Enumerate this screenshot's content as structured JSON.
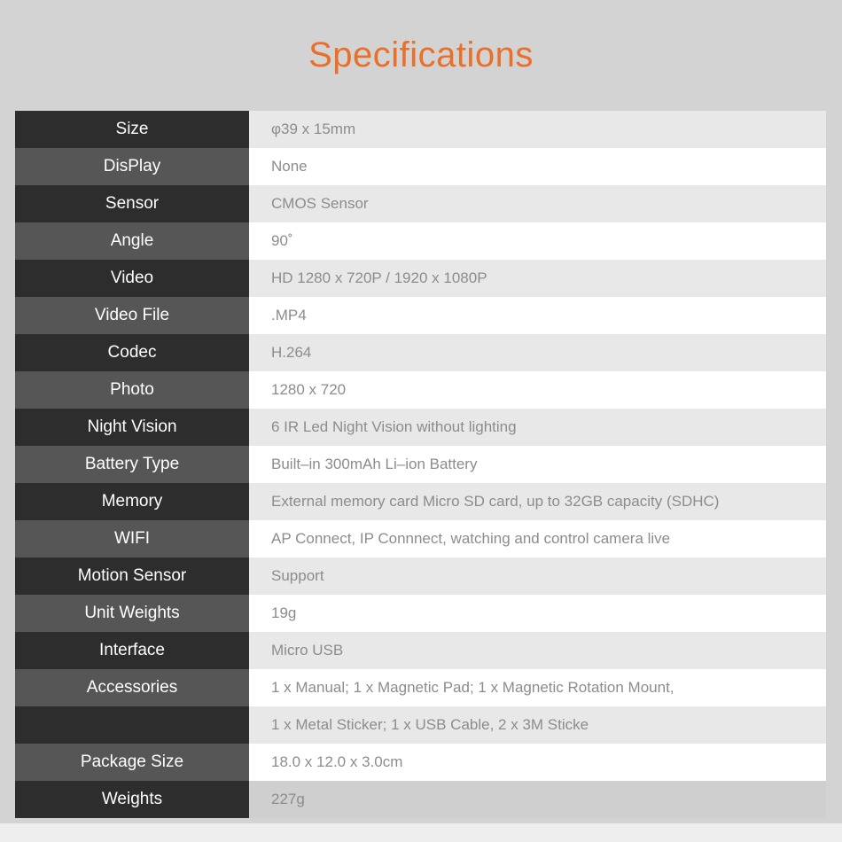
{
  "page": {
    "title": "Specifications",
    "title_color": "#e8702a",
    "background_color": "#d3d3d3"
  },
  "table": {
    "label_colors": {
      "dark": "#2d2d2d",
      "mid": "#565656"
    },
    "value_colors": {
      "dark": "#e8e8e8",
      "mid": "#ffffff",
      "last": "#cfcfcf"
    },
    "rows": [
      {
        "label": "Size",
        "value": "φ39 x 15mm",
        "style": "dark"
      },
      {
        "label": "DisPlay",
        "value": "None",
        "style": "mid"
      },
      {
        "label": "Sensor",
        "value": "CMOS Sensor",
        "style": "dark"
      },
      {
        "label": "Angle",
        "value": "90˚",
        "style": "mid"
      },
      {
        "label": "Video",
        "value": "HD 1280 x 720P / 1920 x 1080P",
        "style": "dark"
      },
      {
        "label": "Video File",
        "value": ".MP4",
        "style": "mid"
      },
      {
        "label": "Codec",
        "value": "H.264",
        "style": "dark"
      },
      {
        "label": "Photo",
        "value": "1280 x 720",
        "style": "mid"
      },
      {
        "label": "Night Vision",
        "value": "6 IR Led Night Vision without lighting",
        "style": "dark"
      },
      {
        "label": "Battery Type",
        "value": "Built–in 300mAh Li–ion Battery",
        "style": "mid"
      },
      {
        "label": "Memory",
        "value": "External memory card Micro SD card, up to 32GB capacity (SDHC)",
        "style": "dark"
      },
      {
        "label": "WIFI",
        "value": "AP Connect,  IP Connnect, watching and control camera live",
        "style": "mid"
      },
      {
        "label": "Motion Sensor",
        "value": "Support",
        "style": "dark"
      },
      {
        "label": "Unit Weights",
        "value": "19g",
        "style": "mid"
      },
      {
        "label": "Interface",
        "value": "Micro USB",
        "style": "dark"
      },
      {
        "label": "Accessories",
        "value": "1 x Manual; 1 x Magnetic Pad; 1 x Magnetic Rotation Mount,",
        "style": "mid"
      },
      {
        "label": "",
        "value": "1 x Metal Sticker; 1 x USB Cable, 2 x 3M Sticke",
        "style": "dark"
      },
      {
        "label": "Package Size",
        "value": "18.0 x 12.0 x 3.0cm",
        "style": "mid"
      },
      {
        "label": "Weights",
        "value": "227g",
        "style": "dark",
        "last": true
      }
    ]
  }
}
